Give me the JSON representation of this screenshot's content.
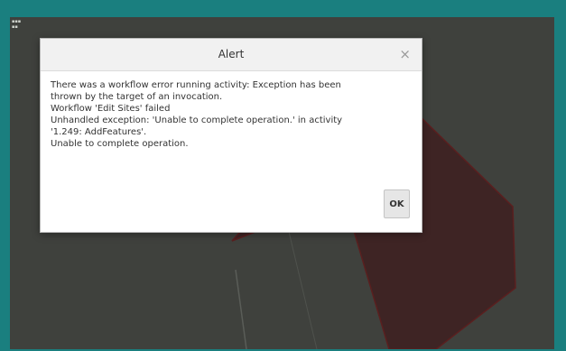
{
  "dialog": {
    "title": "Alert",
    "close_glyph": "×",
    "message_lines": [
      "There was a workflow error running activity: Exception has been",
      "thrown by the target of an invocation.",
      "Workflow 'Edit Sites' failed",
      "Unhandled exception: 'Unable to complete operation.' in activity",
      "'1.249: AddFeatures'.",
      "Unable to complete operation."
    ],
    "ok_label": "OK"
  },
  "colors": {
    "frame": "#1a7f7f",
    "map_background": "#3f413d",
    "parcel_fill": "#3e2424",
    "parcel_stroke": "#5a1f1f"
  }
}
